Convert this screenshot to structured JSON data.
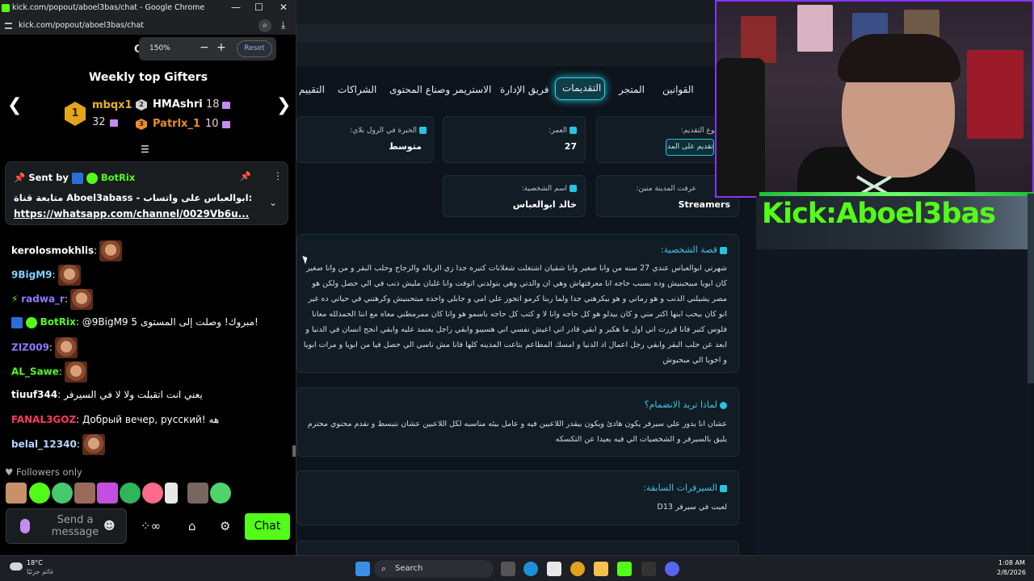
{
  "window": {
    "title": "kick.com/popout/aboel3bas/chat - Google Chrome",
    "url": "kick.com/popout/aboel3bas/chat",
    "minimize": "—",
    "maximize": "☐",
    "close": "✕"
  },
  "zoom": {
    "level": "150%",
    "minus": "−",
    "plus": "+",
    "reset": "Reset"
  },
  "gifters": {
    "title": "Weekly top Gifters",
    "prev": "❮",
    "next": "❯",
    "items": [
      {
        "rank": "1",
        "name": "mbqx1",
        "count": "32",
        "color": "#e8b226"
      },
      {
        "rank": "2",
        "name": "HMAshri",
        "count": "18",
        "color": "#ffffff"
      },
      {
        "rank": "3",
        "name": "Patrlx_1",
        "count": "10",
        "color": "#ea8d2b"
      }
    ],
    "handle": "☰"
  },
  "pinned": {
    "sent_by": "Sent by",
    "sender": "BotRix",
    "line1": "متابعة قناة Aboel3abass - ابوالعباس على واتساب:",
    "line2": "https://whatsapp.com/channel/0029Vb6u...",
    "pin_icon": "📌",
    "more_icon": "⋮",
    "expand_icon": "⌄"
  },
  "chat": [
    {
      "user": "kerolosmokhlis",
      "color": "#ffffff",
      "text": "",
      "emote": true
    },
    {
      "user": "9BigM9",
      "color": "#7fd3ff",
      "text": "",
      "emote": true
    },
    {
      "user": "radwa_r",
      "color": "#8f7cff",
      "text": "",
      "emote": true
    },
    {
      "user": "BotRix",
      "color": "#53fc18",
      "text": "@9BigM9 مبروك! وصلت إلى المستوى 5!",
      "emote": false
    },
    {
      "user": "ZIZ009",
      "color": "#8f7cff",
      "text": "",
      "emote": true
    },
    {
      "user": "AL_Sawe",
      "color": "#53fc18",
      "text": "",
      "emote": true
    },
    {
      "user": "tiuuf344",
      "color": "#ffffff",
      "text": "يعني انت اتقبلت ولا لا في السيرفر",
      "emote": false
    },
    {
      "user": "FANAL3GOZ",
      "color": "#ff3b5c",
      "text": "Добрый вечер, русский! هه",
      "emote": false
    },
    {
      "user": "belal_12340",
      "color": "#b8d7ff",
      "text": "",
      "emote": true
    }
  ],
  "followers_only": "Followers only",
  "input": {
    "placeholder_line1": "Send a",
    "placeholder_line2": "message",
    "send": "Chat"
  },
  "site": {
    "nav": [
      "التقييم",
      "الشراكات",
      "الاستريمر وصناع المحتوى",
      "فريق الإدارة",
      "التقديمات",
      "المتجر",
      "القوانين"
    ],
    "fields": {
      "experience_label": "الخبرة في الرول بلاي:",
      "experience_value": "متوسط",
      "age_label": "العمر:",
      "age_value": "27",
      "apply_label": "نوع التقديم:",
      "apply_button": "تقديم على المدينة",
      "character_label": "اسم الشخصية:",
      "character_value": "خالد ابوالعباس",
      "source_label": "عرفت المدينة منين:",
      "source_value": "Streamers"
    },
    "story_title": "قصة الشخصية:",
    "story_text": "شهرتي ابوالعباس عندي 27 سنه من وانا صغير وانا شقيان اشتغلت شغلانات كتيره جدا زي الزباله والزجاج وحلب البقر و من وانا صغير كان ابويا مبيحبنيش وده بسبب حاجه انا معرفتهاش وهي ان والدتي وهي بتولدني اتوفت وانا غلبان مليش ذنب في الي حصل ولكن هو مصر يشيلني الذنب و هو رماني و هو بيكرهني جدا ولما ربنا كرمو اتجوز علي امي و جابلي واحده مبتحبنيش وكرهتني في حياتي ده غير انو كان بيحب ابنها اكتر مني و كان بيدلو هو كل حاجه وانا لا و كتب كل حاجه باسمو هو وانا كان ممرمطني معاه مع اننا الحمدلله معانا فلوس كتير فانا قررت اني اول ما هكبر و ابقي قادر اني اعيش نفسي اني هسيبو وابقي راجل يعتمد عليه وابقي انجح انسان في الدنيا و ابعد عن حلب البقر وابقي رجل اعمال اد الدنيا و امسك المطاعم بتاعت المدينه كلها فانا مش ناسي الي حصل فيا من ابويا و مرات ابويا و اخويا الي مبحبوش",
    "why_title": "لماذا تريد الانضمام؟",
    "why_text": "عشان انا بدور علي سيرفر يكون هادئ ويكون بيقدر اللاعبين فيه و عامل بيئه مناسبه لكل اللاعبين عشان نتبسط و نقدم محتوي محترم يليق بالسيرفر و الشخصيات الي فيه بعيدا عن التكسكه",
    "servers_title": "السيرفرات السابقة:",
    "servers_text": "لعبت في سيرفر D13"
  },
  "overlay": {
    "banner": "Kick:Aboel3bas"
  },
  "taskbar": {
    "temp": "18°C",
    "weather": "غائم جزئيًا",
    "search": "Search",
    "time": "1:08 AM",
    "date": "2/8/2026"
  },
  "colors": {
    "kick_green": "#53fc18",
    "accent_cyan": "#27c4e0",
    "purple": "#c58cf0"
  }
}
